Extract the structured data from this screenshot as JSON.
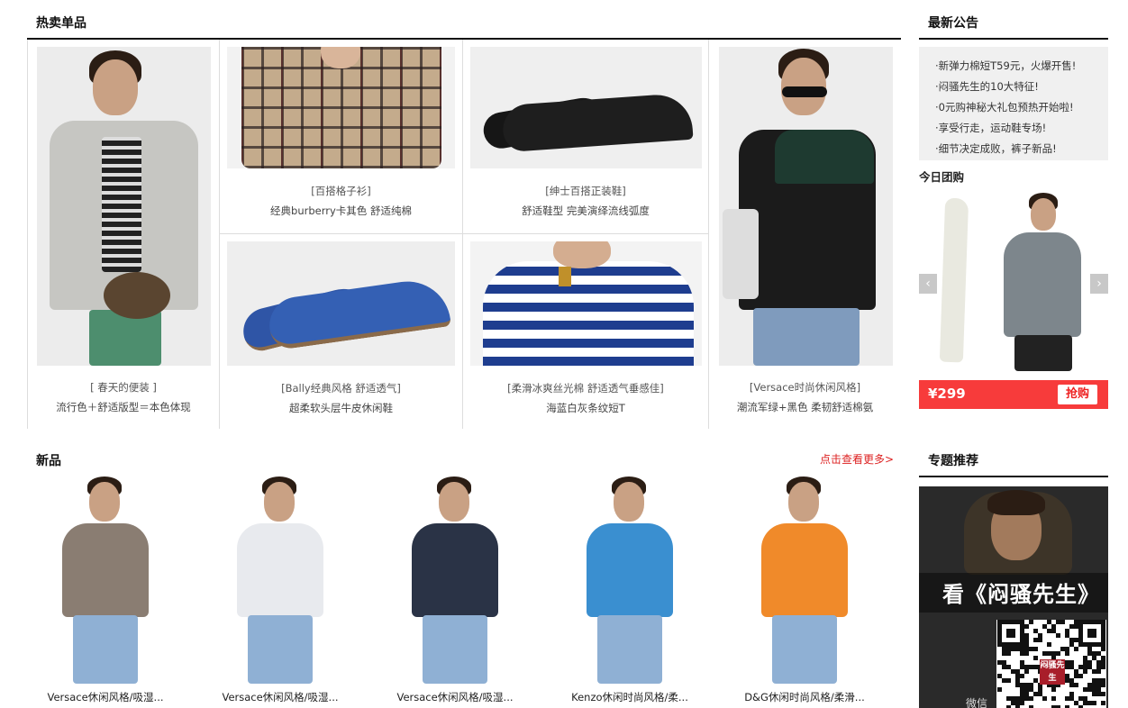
{
  "hot_section": {
    "title": "热卖单品",
    "items": [
      {
        "caption1": "[ 春天的便装 ]",
        "caption2": "流行色＋舒适版型＝本色体现"
      },
      {
        "caption1": "[百搭格子衫]",
        "caption2": "经典burberry卡其色 舒适纯棉"
      },
      {
        "caption1": "[绅士百搭正装鞋]",
        "caption2": "舒适鞋型 完美演绎流线弧度"
      },
      {
        "caption1": "[Versace时尚休闲风格]",
        "caption2": "潮流军绿+黑色 柔韧舒适棉氨"
      },
      {
        "caption1": "[Bally经典风格  舒适透气]",
        "caption2": "超柔软头层牛皮休闲鞋"
      },
      {
        "caption1": "[柔滑冰爽丝光棉 舒适透气垂感佳]",
        "caption2": "海蓝白灰条纹短T"
      }
    ]
  },
  "notice_section": {
    "title": "最新公告",
    "items": [
      "·新弹力棉短T59元，火爆开售!",
      "·闷骚先生的10大特征!",
      "·0元购神秘大礼包预热开始啦!",
      "·享受行走，运动鞋专场!",
      "·细节决定成败，裤子新品!"
    ]
  },
  "group_buy": {
    "title": "今日团购",
    "price": "¥299",
    "buy_label": "抢购",
    "prev_icon": "chevron-left-icon",
    "next_icon": "chevron-right-icon"
  },
  "new_section": {
    "title": "新品",
    "more_label": "点击查看更多>",
    "items": [
      {
        "label": "Versace休闲风格/吸湿...",
        "shirt": "#8a7d72"
      },
      {
        "label": "Versace休闲风格/吸湿...",
        "shirt": "#e8eaee"
      },
      {
        "label": "Versace休闲风格/吸湿...",
        "shirt": "#2a3346"
      },
      {
        "label": "Kenzo休闲时尚风格/柔...",
        "shirt": "#3a8fd0"
      },
      {
        "label": "D&G休闲时尚风格/柔滑...",
        "shirt": "#f08a2a"
      }
    ]
  },
  "topic_section": {
    "title": "专题推荐",
    "banner_text": "看《闷骚先生》",
    "brand_logo_text": "闷骚先生",
    "wechat_label": "微信"
  },
  "colors": {
    "accent_red": "#f73b3b",
    "border": "#dddddd",
    "heading": "#111111"
  }
}
